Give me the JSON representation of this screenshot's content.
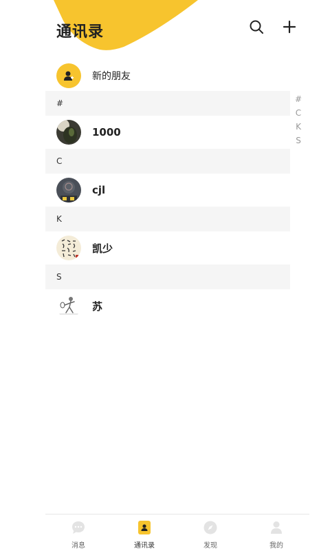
{
  "header": {
    "title": "通讯录",
    "search_icon": "search-icon",
    "add_icon": "plus-icon"
  },
  "colors": {
    "accent": "#F7C42E",
    "section_bg": "#F5F5F5",
    "tab_inactive": "#E3E3E3"
  },
  "new_friends": {
    "label": "新的朋友",
    "icon": "person-add-icon"
  },
  "sections": [
    {
      "letter": "#",
      "contacts": [
        {
          "name": "1000"
        }
      ]
    },
    {
      "letter": "C",
      "contacts": [
        {
          "name": "cjl"
        }
      ]
    },
    {
      "letter": "K",
      "contacts": [
        {
          "name": "凯少"
        }
      ]
    },
    {
      "letter": "S",
      "contacts": [
        {
          "name": "苏"
        }
      ]
    }
  ],
  "index_bar": [
    "#",
    "C",
    "K",
    "S"
  ],
  "tabbar": {
    "active_index": 1,
    "tabs": [
      {
        "label": "消息",
        "icon": "chat-bubble-icon"
      },
      {
        "label": "通讯录",
        "icon": "contacts-icon"
      },
      {
        "label": "发现",
        "icon": "compass-icon"
      },
      {
        "label": "我的",
        "icon": "profile-icon"
      }
    ]
  }
}
